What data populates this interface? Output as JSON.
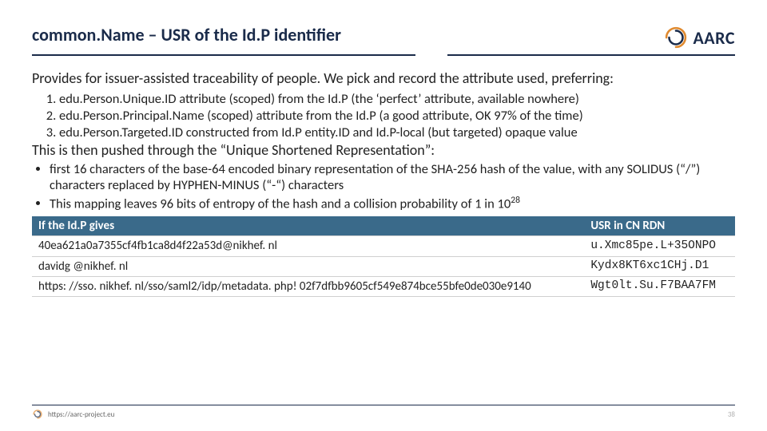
{
  "header": {
    "title": "common.Name – USR of the Id.P identifier",
    "logo_text": "AARC"
  },
  "body": {
    "intro": "Provides for issuer-assisted traceability of people.  We pick and record the attribute used, preferring:",
    "attrs": [
      "edu.Person.Unique.ID attribute (scoped) from the Id.P (the ‘perfect’ attribute, available nowhere)",
      "edu.Person.Principal.Name (scoped) attribute from the Id.P (a good attribute, OK 97% of the time)",
      "edu.Person.Targeted.ID constructed from Id.P entity.ID and Id.P-local (but targeted) opaque value"
    ],
    "pushed": "This is then pushed through the “Unique Shortened Representation”:",
    "bullets": [
      "first 16 characters of the base-64 encoded binary representation of the SHA-256 hash of the value, with any SOLIDUS (“/”) characters replaced by HYPHEN-MINUS (“-“) characters",
      "This mapping leaves 96 bits of entropy of the hash and a collision probability of 1 in 10"
    ],
    "bullet2_sup": "28"
  },
  "table": {
    "col1_header": "If the Id.P gives",
    "col2_header": "USR in CN RDN",
    "rows": [
      {
        "idp": "40ea621a0a7355cf4fb1ca8d4f22a53d@nikhef. nl",
        "usr": "u.Xmc85pe.L+35ONPO"
      },
      {
        "idp": "davidg @nikhef. nl",
        "usr": "Kydx8KT6xc1CHj.D1"
      },
      {
        "idp": "https: //sso. nikhef. nl/sso/saml2/idp/metadata. php! 02f7dfbb9605cf549e874bce55bfe0de030e9140",
        "usr": "Wgt0lt.Su.F7BAA7FM"
      }
    ]
  },
  "footer": {
    "url": "https://aarc-project.eu",
    "page": "38"
  },
  "colors": {
    "brand_dark": "#1a2b4a",
    "table_header": "#3a6a8a",
    "swirl_orange": "#e08a2f"
  }
}
